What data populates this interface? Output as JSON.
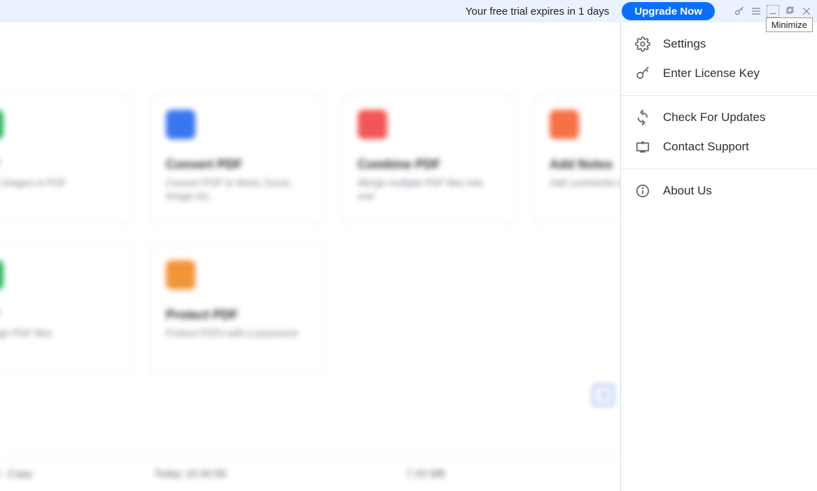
{
  "banner": {
    "trial_text": "Your free trial expires in 1 days",
    "upgrade_label": "Upgrade Now"
  },
  "tooltip": {
    "minimize": "Minimize"
  },
  "menu": {
    "settings": "Settings",
    "license": "Enter License Key",
    "updates": "Check For Updates",
    "support": "Contact Support",
    "about": "About Us"
  },
  "cards": {
    "edit": {
      "title": "PDF",
      "desc": "text & images in PDF",
      "color": "#24b35c"
    },
    "convert": {
      "title": "Convert PDF",
      "desc": "Convert PDF to Word, Excel, Image etc.",
      "color": "#2e6ff2"
    },
    "combine": {
      "title": "Combine PDF",
      "desc": "Merge multiple PDF files into one",
      "color": "#f24e4e"
    },
    "notes": {
      "title": "Add Notes",
      "desc": "Add comments sticky notes",
      "color": "#f66a3c"
    },
    "sign": {
      "title": "PDF",
      "desc": "ally sign PDF files",
      "color": "#24b35c"
    },
    "protect": {
      "title": "Protect PDF",
      "desc": "Protect PDFs with a password",
      "color": "#f2902e"
    }
  },
  "recent": {
    "name": "ers of\n- Copy",
    "date": "Today 16:46:58",
    "size": "7.33 MB"
  }
}
